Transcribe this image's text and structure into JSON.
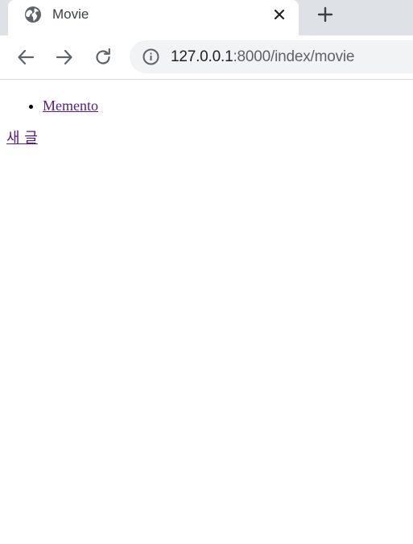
{
  "browser": {
    "tab": {
      "title": "Movie",
      "favicon": "globe-icon",
      "close_icon": "close-icon"
    },
    "new_tab_icon": "plus-icon",
    "toolbar": {
      "back_icon": "back-arrow-icon",
      "forward_icon": "forward-arrow-icon",
      "reload_icon": "reload-icon"
    },
    "omnibox": {
      "info_icon": "info-icon",
      "url_host": "127.0.0.1",
      "url_path": ":8000/index/movie"
    },
    "colors": {
      "tabstrip_bg": "#dee1e6",
      "omnibox_bg": "#f1f3f4",
      "icon": "#5f6368",
      "link_visited": "#551a8b"
    }
  },
  "page": {
    "posts": [
      {
        "title": "Memento"
      }
    ],
    "new_post_label": "새 글"
  }
}
